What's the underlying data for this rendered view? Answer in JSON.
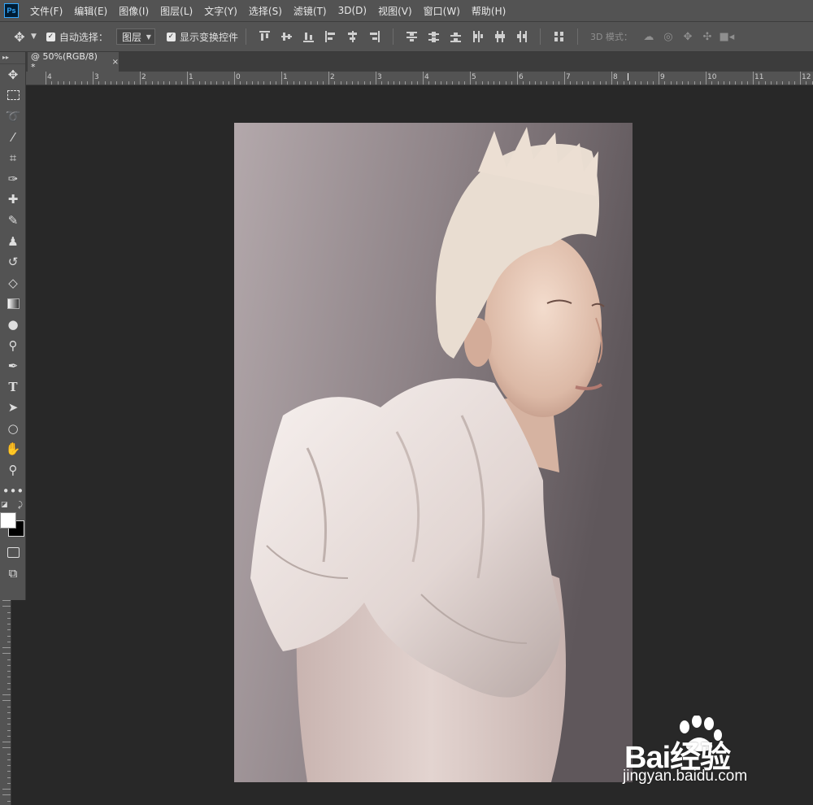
{
  "app": {
    "logo_text": "Ps"
  },
  "menu": [
    "文件(F)",
    "编辑(E)",
    "图像(I)",
    "图层(L)",
    "文字(Y)",
    "选择(S)",
    "滤镜(T)",
    "3D(D)",
    "视图(V)",
    "窗口(W)",
    "帮助(H)"
  ],
  "options": {
    "auto_select_label": "自动选择：",
    "auto_select_checked": true,
    "auto_select_target": "图层",
    "show_transform_label": "显示变换控件",
    "show_transform_checked": true,
    "mode_3d_label": "3D 模式："
  },
  "document": {
    "tab_title": "@ 50%(RGB/8) *",
    "close_glyph": "×"
  },
  "ruler": {
    "labels": [
      "4",
      "3",
      "2",
      "1",
      "0",
      "1",
      "2",
      "3",
      "4",
      "5",
      "6",
      "7",
      "8",
      "9",
      "10",
      "11",
      "12"
    ]
  },
  "colors": {
    "foreground": "#ffffff",
    "background": "#000000",
    "ui_panel": "#535353",
    "workspace": "#282828"
  },
  "tools": [
    "move-tool-icon",
    "marquee-tool-icon",
    "lasso-tool-icon",
    "magic-wand-tool-icon",
    "crop-tool-icon",
    "eyedropper-tool-icon",
    "healing-brush-tool-icon",
    "brush-tool-icon",
    "clone-stamp-tool-icon",
    "history-brush-tool-icon",
    "eraser-tool-icon",
    "gradient-tool-icon",
    "blur-tool-icon",
    "dodge-tool-icon",
    "pen-tool-icon",
    "type-tool-icon",
    "path-selection-tool-icon",
    "ellipse-tool-icon",
    "hand-tool-icon",
    "zoom-tool-icon",
    "more-tools-icon"
  ],
  "watermark": {
    "brand": "Bai经验",
    "domain": "jingyan.baidu.com"
  }
}
